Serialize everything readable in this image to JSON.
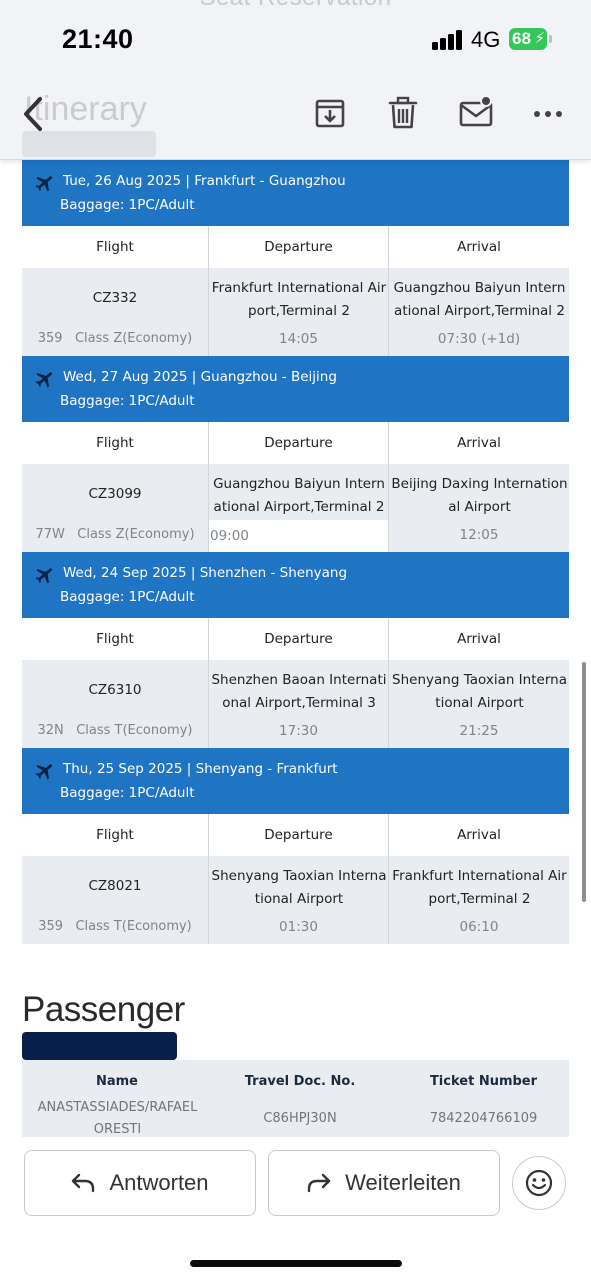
{
  "status_bar": {
    "time": "21:40",
    "network": "4G",
    "battery": "68"
  },
  "header": {
    "ghost_title": "Seat Reservation",
    "ghost_section": "Itinerary"
  },
  "toolbar": {
    "back": "chevron-left-icon",
    "actions": [
      "archive-icon",
      "trash-icon",
      "mail-unread-icon",
      "more-icon"
    ]
  },
  "itinerary": {
    "columns": {
      "flight": "Flight",
      "departure": "Departure",
      "arrival": "Arrival"
    },
    "segments": [
      {
        "date_route": "Tue, 26 Aug 2025 | Frankfurt - Guangzhou",
        "baggage": "Baggage: 1PC/Adult",
        "flight": "CZ332",
        "aircraft": "359",
        "class": "Class Z(Economy)",
        "departure_airport": "Frankfurt International Airport,Terminal 2",
        "departure_time": "14:05",
        "arrival_airport": "Guangzhou Baiyun International Airport,Terminal 2",
        "arrival_time": "07:30 (+1d)"
      },
      {
        "date_route": "Wed, 27 Aug 2025 | Guangzhou - Beijing",
        "baggage": "Baggage: 1PC/Adult",
        "flight": "CZ3099",
        "aircraft": "77W",
        "class": "Class Z(Economy)",
        "departure_airport": "Guangzhou Baiyun International Airport,Terminal 2",
        "departure_time": "09:00",
        "arrival_airport": "Beijing Daxing International Airport",
        "arrival_time": "12:05"
      },
      {
        "date_route": "Wed, 24 Sep 2025 | Shenzhen - Shenyang",
        "baggage": "Baggage: 1PC/Adult",
        "flight": "CZ6310",
        "aircraft": "32N",
        "class": "Class T(Economy)",
        "departure_airport": "Shenzhen Baoan International Airport,Terminal 3",
        "departure_time": "17:30",
        "arrival_airport": "Shenyang Taoxian International Airport",
        "arrival_time": "21:25"
      },
      {
        "date_route": "Thu, 25 Sep 2025 | Shenyang - Frankfurt",
        "baggage": "Baggage: 1PC/Adult",
        "flight": "CZ8021",
        "aircraft": "359",
        "class": "Class T(Economy)",
        "departure_airport": "Shenyang Taoxian International Airport",
        "departure_time": "01:30",
        "arrival_airport": "Frankfurt International Airport,Terminal 2",
        "arrival_time": "06:10"
      }
    ]
  },
  "passenger": {
    "title": "Passenger",
    "headers": {
      "name": "Name",
      "doc": "Travel Doc. No.",
      "ticket": "Ticket Number"
    },
    "rows": [
      {
        "name": "ANASTASSIADES/RAFAEL ORESTI",
        "doc": "C86HPJ30N",
        "ticket": "7842204766109"
      }
    ]
  },
  "actions": {
    "reply": "Antworten",
    "forward": "Weiterleiten"
  },
  "colors": {
    "segment_header": "#1f74c4",
    "row_bg": "#e9ecf0",
    "redaction": "#071f4a",
    "battery": "#34c759"
  }
}
